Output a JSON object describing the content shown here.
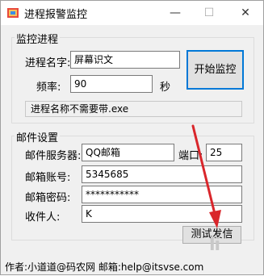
{
  "window": {
    "title": "进程报警监控",
    "min_glyph": "—",
    "max_glyph": "☐",
    "close_glyph": "✕"
  },
  "monitor": {
    "group_title": "监控进程",
    "process_name_label": "进程名字:",
    "process_name_value": "屏幕识文",
    "frequency_label": "频率:",
    "frequency_value": "90",
    "frequency_unit": "秒",
    "start_button": "开始监控",
    "hint": "进程名称不需要带.exe"
  },
  "mail": {
    "group_title": "邮件设置",
    "server_label": "邮件服务器:",
    "server_value": "QQ邮箱",
    "port_label": "端口:",
    "port_value": "25",
    "account_label": "邮箱账号:",
    "account_value": "5345685",
    "password_label": "邮箱密码:",
    "password_value": "***********",
    "recipient_label": "收件人:",
    "recipient_value": "K",
    "test_button": "测试发信"
  },
  "footer": {
    "text": "作者:小道道@码农网   邮箱:help@itsvse.com"
  },
  "annotation": {
    "arrow_color": "#d9262b"
  }
}
